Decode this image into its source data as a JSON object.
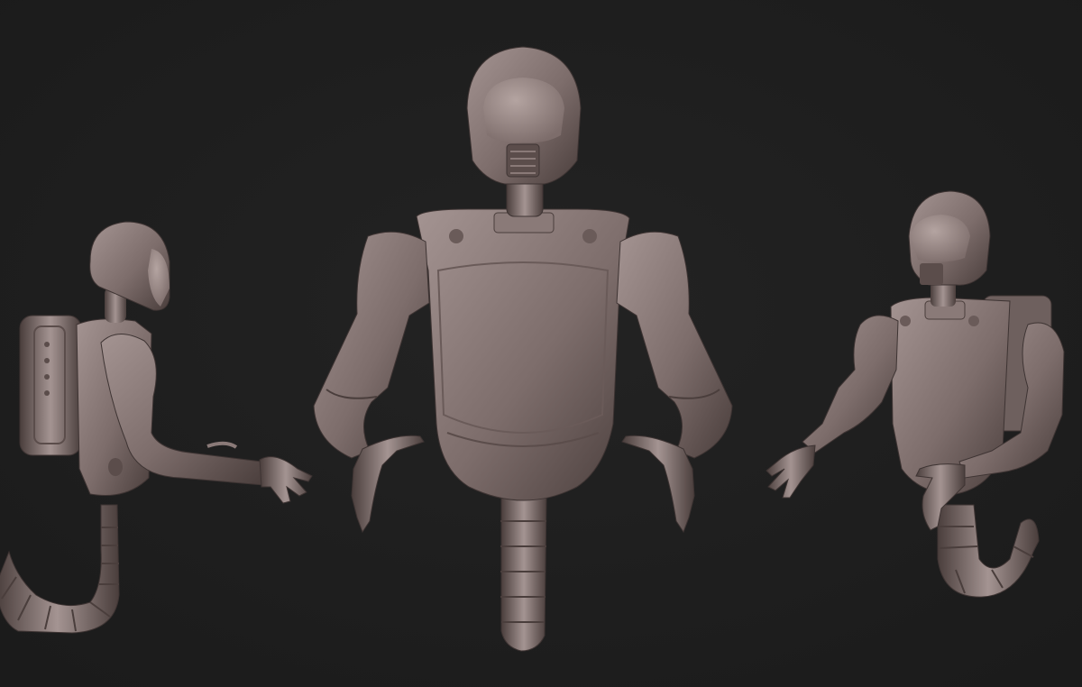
{
  "scene": {
    "background": "#1b1b1b",
    "vignette_center": "#232323",
    "clay": "#7d6d6b",
    "clay_light": "#a49492",
    "clay_dark": "#4a3e3c",
    "visor": "#b4a4a1",
    "figures": [
      {
        "view": "side",
        "has_backpack": true
      },
      {
        "view": "front",
        "has_backpack": false
      },
      {
        "view": "three-quarter",
        "has_backpack": true
      }
    ]
  }
}
